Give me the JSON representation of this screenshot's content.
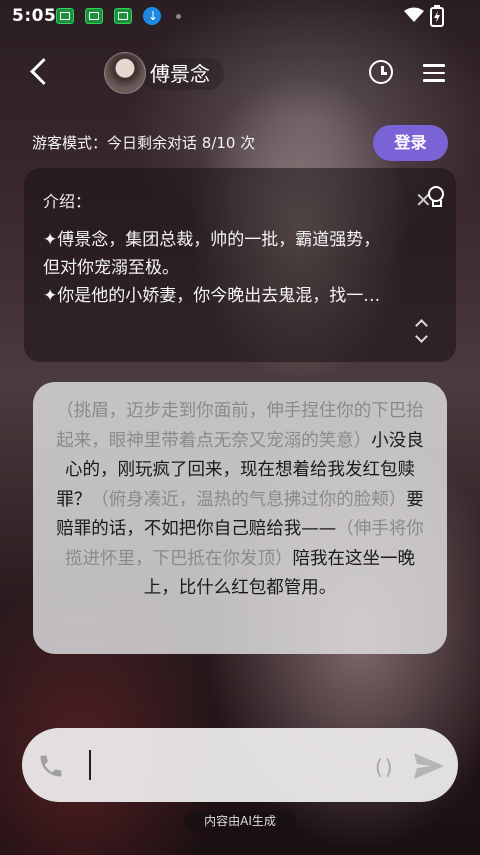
{
  "status_bar": {
    "time": "5:05"
  },
  "header": {
    "character_name": "傅景念"
  },
  "guest_bar": {
    "text": "游客模式：今日剩余对话 8/10 次",
    "login_label": "登录",
    "accent": "#7a63d6"
  },
  "intro": {
    "title": "介绍：",
    "lines": [
      "✦傅景念，集团总裁，帅的一批，霸道强势，",
      "但对你宠溺至极。",
      "✦你是他的小娇妻，你今晚出去鬼混，找一…"
    ]
  },
  "message": {
    "segments": [
      {
        "text": "（挑眉，迈步走到你面前，伸手捏住你的下巴抬起来，眼神里带着点无奈又宠溺的笑意）",
        "kind": "action"
      },
      {
        "text": "小没良心的，刚玩疯了回来，现在想着给我发红包赎罪？",
        "kind": "speech"
      },
      {
        "text": "（俯身凑近，温热的气息拂过你的脸颊）",
        "kind": "action"
      },
      {
        "text": "要赔罪的话，不如把你自己赔给我——",
        "kind": "speech"
      },
      {
        "text": "（伸手将你揽进怀里，下巴抵在你发顶）",
        "kind": "action"
      },
      {
        "text": "陪我在这坐一晚上，比什么红包都管用。",
        "kind": "speech"
      }
    ]
  },
  "input": {
    "paren_hint": "()",
    "value": ""
  },
  "footer": {
    "ai_notice": "内容由AI生成"
  },
  "icons": [
    "back-icon",
    "clock-icon",
    "menu-icon",
    "lightbulb-icon",
    "close-icon",
    "expand-icon",
    "phone-icon",
    "send-icon",
    "download-icon",
    "wifi-icon",
    "battery-icon"
  ]
}
